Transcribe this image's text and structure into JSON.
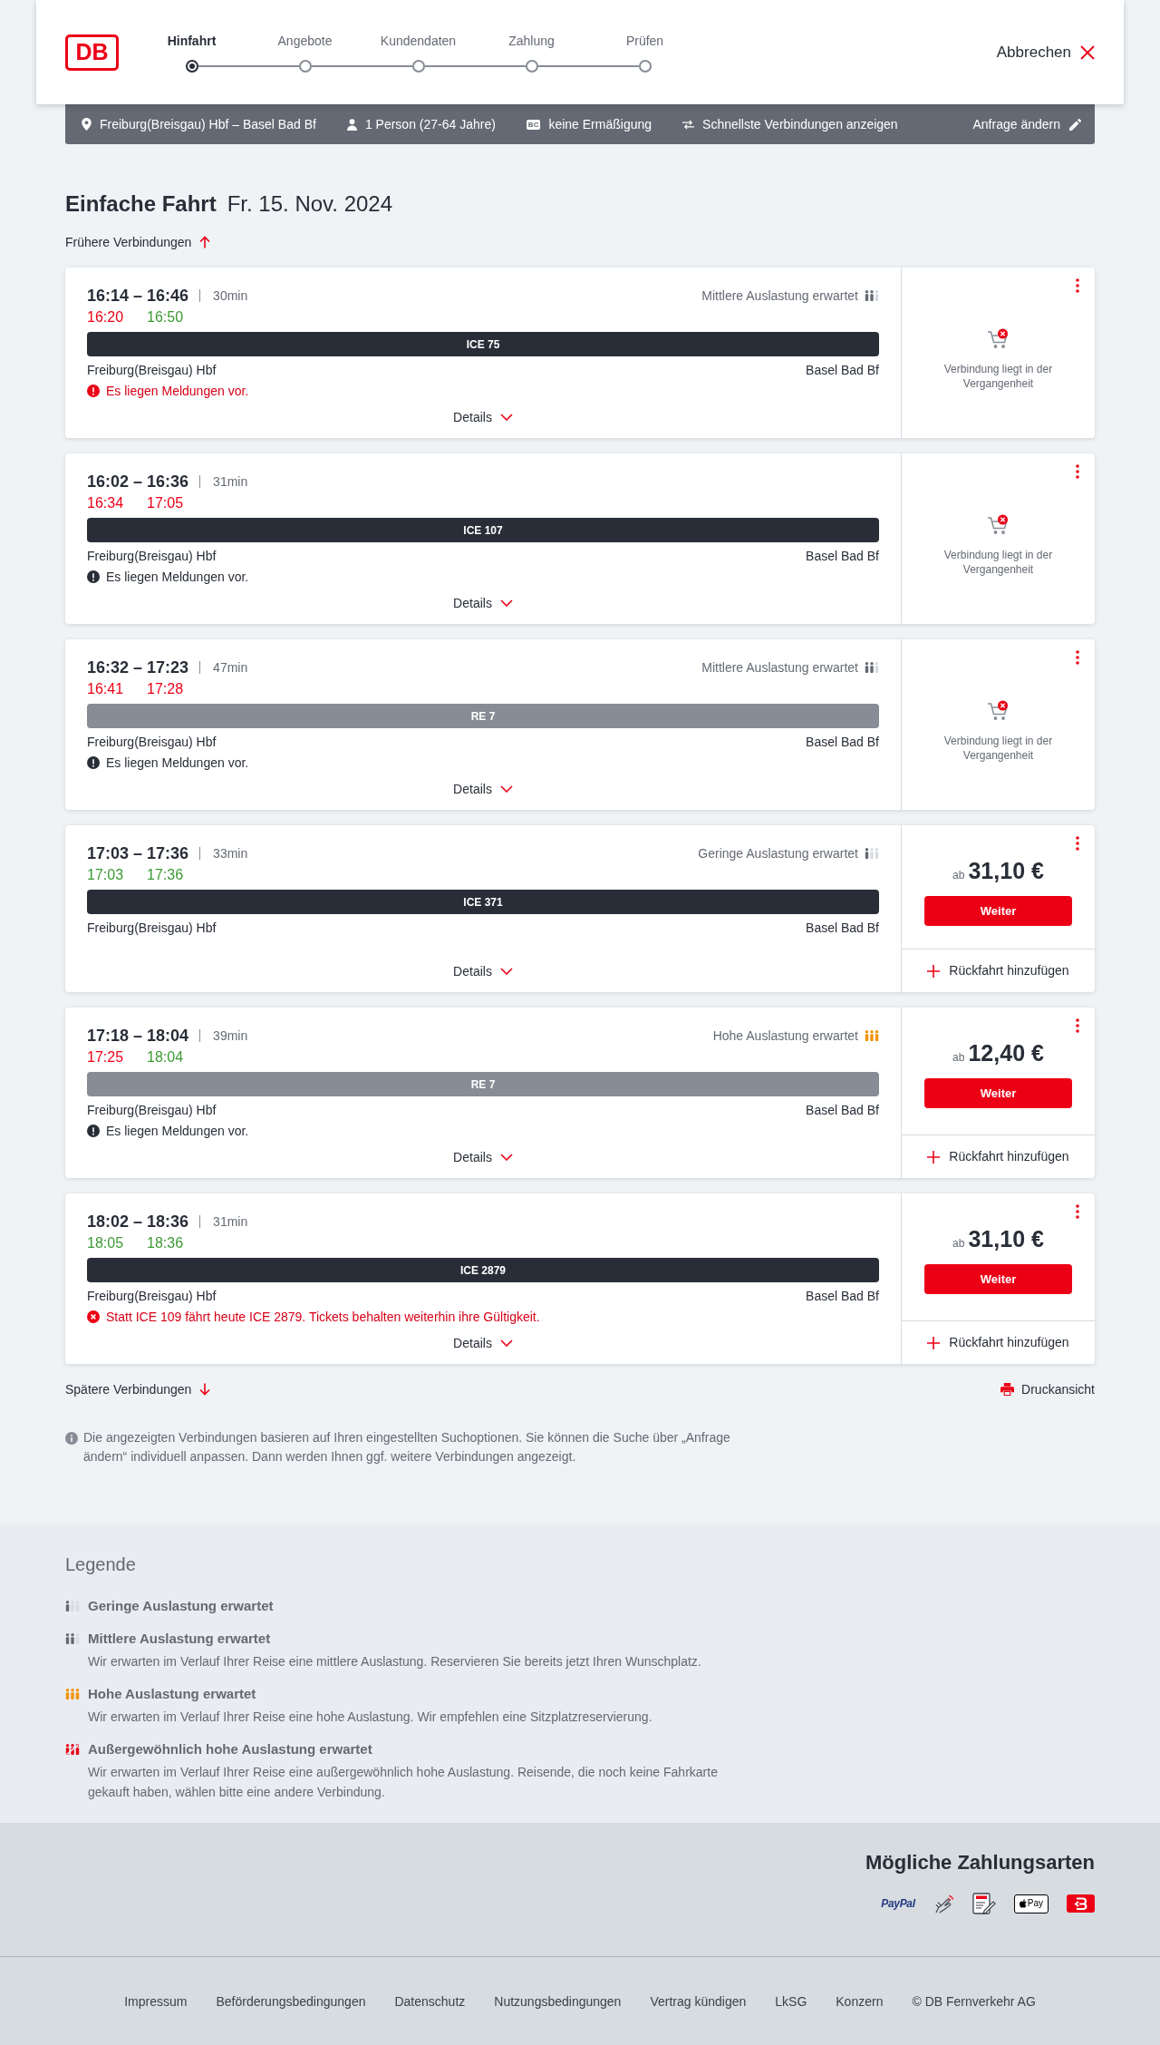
{
  "header": {
    "logo": "DB",
    "steps": [
      {
        "label": "Hinfahrt",
        "selected": true
      },
      {
        "label": "Angebote",
        "selected": false
      },
      {
        "label": "Kundendaten",
        "selected": false
      },
      {
        "label": "Zahlung",
        "selected": false
      },
      {
        "label": "Prüfen",
        "selected": false
      }
    ],
    "cancel": "Abbrechen"
  },
  "search_summary": {
    "items": [
      {
        "kind": "route",
        "text": "Freiburg(Breisgau) Hbf – Basel Bad Bf"
      },
      {
        "kind": "passengers",
        "text": "1 Person (27-64 Jahre)"
      },
      {
        "kind": "discount",
        "badge": "BC",
        "text": "keine Ermäßigung"
      },
      {
        "kind": "sorting",
        "text": "Schnellste Verbindungen anzeigen"
      }
    ],
    "edit": "Anfrage ändern"
  },
  "heading": {
    "title": "Einfache Fahrt",
    "date": "Fr. 15. Nov. 2024"
  },
  "earlier_link": "Frühere Verbindungen",
  "connections": [
    {
      "times": "16:14 – 16:46",
      "duration": "30min",
      "occupancy": {
        "kind": "medium",
        "label": "Mittlere Auslastung erwartet"
      },
      "realtime": [
        {
          "time": "16:20",
          "delayed": true
        },
        {
          "time": "16:50",
          "delayed": false
        }
      ],
      "train": {
        "name": "ICE 75",
        "kind": "long_distance"
      },
      "from": "Freiburg(Breisgau) Hbf",
      "to": "Basel Bad Bf",
      "message": {
        "kind": "priority",
        "text": "Es liegen Meldungen vor."
      },
      "details": "Details",
      "offer": {
        "kind": "past",
        "text": "Verbindung liegt in der Vergangenheit"
      }
    },
    {
      "times": "16:02 – 16:36",
      "duration": "31min",
      "realtime": [
        {
          "time": "16:34",
          "delayed": true
        },
        {
          "time": "17:05",
          "delayed": true
        }
      ],
      "train": {
        "name": "ICE 107",
        "kind": "long_distance"
      },
      "from": "Freiburg(Breisgau) Hbf",
      "to": "Basel Bad Bf",
      "message": {
        "kind": "standard",
        "text": "Es liegen Meldungen vor."
      },
      "details": "Details",
      "offer": {
        "kind": "past",
        "text": "Verbindung liegt in der Vergangenheit"
      }
    },
    {
      "times": "16:32 – 17:23",
      "duration": "47min",
      "occupancy": {
        "kind": "medium",
        "label": "Mittlere Auslastung erwartet"
      },
      "realtime": [
        {
          "time": "16:41",
          "delayed": true
        },
        {
          "time": "17:28",
          "delayed": true
        }
      ],
      "train": {
        "name": "RE 7",
        "kind": "regional"
      },
      "from": "Freiburg(Breisgau) Hbf",
      "to": "Basel Bad Bf",
      "message": {
        "kind": "standard",
        "text": "Es liegen Meldungen vor."
      },
      "details": "Details",
      "offer": {
        "kind": "past",
        "text": "Verbindung liegt in der Vergangenheit"
      }
    },
    {
      "times": "17:03 – 17:36",
      "duration": "33min",
      "occupancy": {
        "kind": "low",
        "label": "Geringe Auslastung erwartet"
      },
      "realtime": [
        {
          "time": "17:03",
          "delayed": false
        },
        {
          "time": "17:36",
          "delayed": false
        }
      ],
      "train": {
        "name": "ICE 371",
        "kind": "long_distance"
      },
      "from": "Freiburg(Breisgau) Hbf",
      "to": "Basel Bad Bf",
      "details": "Details",
      "offer": {
        "kind": "price",
        "prefix": "ab",
        "price": "31,10 €",
        "button": "Weiter",
        "return": "Rückfahrt hinzufügen"
      }
    },
    {
      "times": "17:18 – 18:04",
      "duration": "39min",
      "occupancy": {
        "kind": "high",
        "label": "Hohe Auslastung erwartet"
      },
      "realtime": [
        {
          "time": "17:25",
          "delayed": true
        },
        {
          "time": "18:04",
          "delayed": false
        }
      ],
      "train": {
        "name": "RE 7",
        "kind": "regional"
      },
      "from": "Freiburg(Breisgau) Hbf",
      "to": "Basel Bad Bf",
      "message": {
        "kind": "standard",
        "text": "Es liegen Meldungen vor."
      },
      "details": "Details",
      "offer": {
        "kind": "price",
        "prefix": "ab",
        "price": "12,40 €",
        "button": "Weiter",
        "return": "Rückfahrt hinzufügen"
      }
    },
    {
      "times": "18:02 – 18:36",
      "duration": "31min",
      "realtime": [
        {
          "time": "18:05",
          "delayed": false
        },
        {
          "time": "18:36",
          "delayed": false
        }
      ],
      "train": {
        "name": "ICE 2879",
        "kind": "long_distance"
      },
      "from": "Freiburg(Breisgau) Hbf",
      "to": "Basel Bad Bf",
      "message": {
        "kind": "replacement",
        "text": "Statt ICE 109 fährt heute ICE 2879. Tickets behalten weiterhin ihre Gültigkeit."
      },
      "details": "Details",
      "offer": {
        "kind": "price",
        "prefix": "ab",
        "price": "31,10 €",
        "button": "Weiter",
        "return": "Rückfahrt hinzufügen"
      }
    }
  ],
  "later_link": "Spätere Verbindungen",
  "print_link": "Druckansicht",
  "note": "Die angezeigten Verbindungen basieren auf Ihren eingestellten Suchoptionen. Sie können die Suche über „Anfrage ändern“ individuell anpassen. Dann werden Ihnen ggf. weitere Verbindungen angezeigt.",
  "legend": {
    "title": "Legende",
    "items": [
      {
        "kind": "low",
        "title": "Geringe Auslastung erwartet"
      },
      {
        "kind": "medium",
        "title": "Mittlere Auslastung erwartet",
        "description": "Wir erwarten im Verlauf Ihrer Reise eine mittlere Auslastung. Reservieren Sie bereits jetzt Ihren Wunschplatz."
      },
      {
        "kind": "high",
        "title": "Hohe Auslastung erwartet",
        "description": "Wir erwarten im Verlauf Ihrer Reise eine hohe Auslastung. Wir empfehlen eine Sitzplatzreservierung."
      },
      {
        "kind": "extreme",
        "title": "Außergewöhnlich hohe Auslastung erwartet",
        "description": "Wir erwarten im Verlauf Ihrer Reise eine außergewöhnlich hohe Auslastung. Reisende, die noch keine Fahrkarte gekauft haben, wählen bitte eine andere Verbindung."
      }
    ]
  },
  "payment": {
    "title": "Mögliche Zahlungsarten",
    "methods": [
      {
        "kind": "paypal",
        "label": "PayPal"
      },
      {
        "kind": "contactless"
      },
      {
        "kind": "sepa"
      },
      {
        "kind": "apple_pay",
        "label": "Pay"
      },
      {
        "kind": "db_app"
      }
    ]
  },
  "footer": {
    "links": [
      "Impressum",
      "Beförderungsbedingungen",
      "Datenschutz",
      "Nutzungsbedingungen",
      "Vertrag kündigen",
      "LkSG",
      "Konzern"
    ],
    "copyright": "© DB Fernverkehr AG"
  }
}
